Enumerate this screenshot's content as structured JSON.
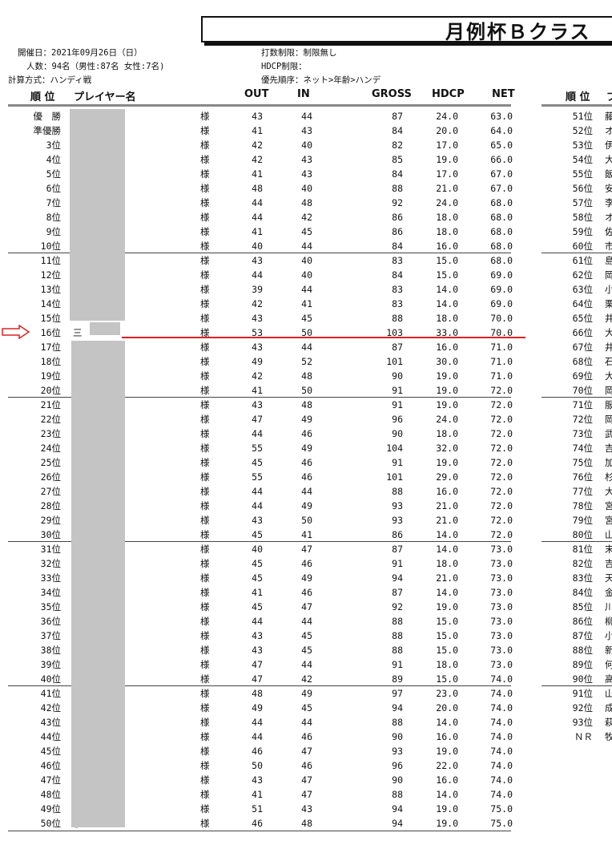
{
  "title": "月例杯Ｂクラス",
  "meta": {
    "date": "開催日：2021年09月26日（日）",
    "count": "人数：94名（男性:87名 女性:7名)",
    "calc": "計算方式：ハンディ戦",
    "limit": "打数制限：制限無し",
    "hdcp_limit": "HDCP制限：",
    "priority": "優先順序：ネット>年齢>ハンデ"
  },
  "headers": {
    "rank": "順 位",
    "player": "プレイヤー名",
    "out": "OUT",
    "in": "IN",
    "gross": "GROSS",
    "hdcp": "HDCP",
    "net": "NET",
    "rank2": "順 位",
    "player2_partial": "プ"
  },
  "honorific": "様",
  "left_rows": [
    {
      "rank": "優　勝",
      "name": "",
      "out": "43",
      "in": "44",
      "gross": "87",
      "hdcp": "24.0",
      "net": "63.0"
    },
    {
      "rank": "準優勝",
      "name": "",
      "out": "41",
      "in": "43",
      "gross": "84",
      "hdcp": "20.0",
      "net": "64.0"
    },
    {
      "rank": "3位",
      "name": "",
      "out": "42",
      "in": "40",
      "gross": "82",
      "hdcp": "17.0",
      "net": "65.0"
    },
    {
      "rank": "4位",
      "name": "",
      "out": "42",
      "in": "43",
      "gross": "85",
      "hdcp": "19.0",
      "net": "66.0"
    },
    {
      "rank": "5位",
      "name": "",
      "out": "41",
      "in": "43",
      "gross": "84",
      "hdcp": "17.0",
      "net": "67.0"
    },
    {
      "rank": "6位",
      "name": "",
      "out": "48",
      "in": "40",
      "gross": "88",
      "hdcp": "21.0",
      "net": "67.0"
    },
    {
      "rank": "7位",
      "name": "",
      "out": "44",
      "in": "48",
      "gross": "92",
      "hdcp": "24.0",
      "net": "68.0"
    },
    {
      "rank": "8位",
      "name": "",
      "out": "44",
      "in": "42",
      "gross": "86",
      "hdcp": "18.0",
      "net": "68.0"
    },
    {
      "rank": "9位",
      "name": "",
      "out": "41",
      "in": "45",
      "gross": "86",
      "hdcp": "18.0",
      "net": "68.0"
    },
    {
      "rank": "10位",
      "name": "",
      "out": "40",
      "in": "44",
      "gross": "84",
      "hdcp": "16.0",
      "net": "68.0"
    },
    {
      "rank": "11位",
      "name": "",
      "out": "43",
      "in": "40",
      "gross": "83",
      "hdcp": "15.0",
      "net": "68.0"
    },
    {
      "rank": "12位",
      "name": "",
      "out": "44",
      "in": "40",
      "gross": "84",
      "hdcp": "15.0",
      "net": "69.0"
    },
    {
      "rank": "13位",
      "name": "",
      "out": "39",
      "in": "44",
      "gross": "83",
      "hdcp": "14.0",
      "net": "69.0"
    },
    {
      "rank": "14位",
      "name": "",
      "out": "42",
      "in": "41",
      "gross": "83",
      "hdcp": "14.0",
      "net": "69.0"
    },
    {
      "rank": "15位",
      "name": "",
      "out": "43",
      "in": "45",
      "gross": "88",
      "hdcp": "18.0",
      "net": "70.0"
    },
    {
      "rank": "16位",
      "name": "三",
      "out": "53",
      "in": "50",
      "gross": "103",
      "hdcp": "33.0",
      "net": "70.0"
    },
    {
      "rank": "17位",
      "name": "",
      "out": "43",
      "in": "44",
      "gross": "87",
      "hdcp": "16.0",
      "net": "71.0"
    },
    {
      "rank": "18位",
      "name": "",
      "out": "49",
      "in": "52",
      "gross": "101",
      "hdcp": "30.0",
      "net": "71.0"
    },
    {
      "rank": "19位",
      "name": "",
      "out": "42",
      "in": "48",
      "gross": "90",
      "hdcp": "19.0",
      "net": "71.0"
    },
    {
      "rank": "20位",
      "name": "",
      "out": "41",
      "in": "50",
      "gross": "91",
      "hdcp": "19.0",
      "net": "72.0"
    },
    {
      "rank": "21位",
      "name": "",
      "out": "43",
      "in": "48",
      "gross": "91",
      "hdcp": "19.0",
      "net": "72.0"
    },
    {
      "rank": "22位",
      "name": "",
      "out": "47",
      "in": "49",
      "gross": "96",
      "hdcp": "24.0",
      "net": "72.0"
    },
    {
      "rank": "23位",
      "name": "",
      "out": "44",
      "in": "46",
      "gross": "90",
      "hdcp": "18.0",
      "net": "72.0"
    },
    {
      "rank": "24位",
      "name": "",
      "out": "55",
      "in": "49",
      "gross": "104",
      "hdcp": "32.0",
      "net": "72.0"
    },
    {
      "rank": "25位",
      "name": "",
      "out": "45",
      "in": "46",
      "gross": "91",
      "hdcp": "19.0",
      "net": "72.0"
    },
    {
      "rank": "26位",
      "name": "吾",
      "out": "55",
      "in": "46",
      "gross": "101",
      "hdcp": "29.0",
      "net": "72.0"
    },
    {
      "rank": "27位",
      "name": "正",
      "out": "44",
      "in": "44",
      "gross": "88",
      "hdcp": "16.0",
      "net": "72.0"
    },
    {
      "rank": "28位",
      "name": "",
      "out": "44",
      "in": "49",
      "gross": "93",
      "hdcp": "21.0",
      "net": "72.0"
    },
    {
      "rank": "29位",
      "name": "",
      "out": "43",
      "in": "50",
      "gross": "93",
      "hdcp": "21.0",
      "net": "72.0"
    },
    {
      "rank": "30位",
      "name": "",
      "out": "45",
      "in": "41",
      "gross": "86",
      "hdcp": "14.0",
      "net": "72.0"
    },
    {
      "rank": "31位",
      "name": "",
      "out": "40",
      "in": "47",
      "gross": "87",
      "hdcp": "14.0",
      "net": "73.0"
    },
    {
      "rank": "32位",
      "name": "",
      "out": "45",
      "in": "46",
      "gross": "91",
      "hdcp": "18.0",
      "net": "73.0"
    },
    {
      "rank": "33位",
      "name": "",
      "out": "45",
      "in": "49",
      "gross": "94",
      "hdcp": "21.0",
      "net": "73.0"
    },
    {
      "rank": "34位",
      "name": "",
      "out": "41",
      "in": "46",
      "gross": "87",
      "hdcp": "14.0",
      "net": "73.0"
    },
    {
      "rank": "35位",
      "name": "",
      "out": "45",
      "in": "47",
      "gross": "92",
      "hdcp": "19.0",
      "net": "73.0"
    },
    {
      "rank": "36位",
      "name": "",
      "out": "44",
      "in": "44",
      "gross": "88",
      "hdcp": "15.0",
      "net": "73.0"
    },
    {
      "rank": "37位",
      "name": "ー",
      "out": "43",
      "in": "45",
      "gross": "88",
      "hdcp": "15.0",
      "net": "73.0"
    },
    {
      "rank": "38位",
      "name": "",
      "out": "43",
      "in": "45",
      "gross": "88",
      "hdcp": "15.0",
      "net": "73.0"
    },
    {
      "rank": "39位",
      "name": "",
      "out": "47",
      "in": "44",
      "gross": "91",
      "hdcp": "18.0",
      "net": "73.0"
    },
    {
      "rank": "40位",
      "name": "",
      "out": "47",
      "in": "42",
      "gross": "89",
      "hdcp": "15.0",
      "net": "74.0"
    },
    {
      "rank": "41位",
      "name": "",
      "out": "48",
      "in": "49",
      "gross": "97",
      "hdcp": "23.0",
      "net": "74.0"
    },
    {
      "rank": "42位",
      "name": "",
      "out": "49",
      "in": "45",
      "gross": "94",
      "hdcp": "20.0",
      "net": "74.0"
    },
    {
      "rank": "43位",
      "name": "志",
      "out": "44",
      "in": "44",
      "gross": "88",
      "hdcp": "14.0",
      "net": "74.0"
    },
    {
      "rank": "44位",
      "name": "",
      "out": "44",
      "in": "46",
      "gross": "90",
      "hdcp": "16.0",
      "net": "74.0"
    },
    {
      "rank": "45位",
      "name": "",
      "out": "46",
      "in": "47",
      "gross": "93",
      "hdcp": "19.0",
      "net": "74.0"
    },
    {
      "rank": "46位",
      "name": "",
      "out": "50",
      "in": "46",
      "gross": "96",
      "hdcp": "22.0",
      "net": "74.0"
    },
    {
      "rank": "47位",
      "name": "",
      "out": "43",
      "in": "47",
      "gross": "90",
      "hdcp": "16.0",
      "net": "74.0"
    },
    {
      "rank": "48位",
      "name": "路",
      "out": "41",
      "in": "47",
      "gross": "88",
      "hdcp": "14.0",
      "net": "74.0"
    },
    {
      "rank": "49位",
      "name": "",
      "out": "51",
      "in": "43",
      "gross": "94",
      "hdcp": "19.0",
      "net": "75.0"
    },
    {
      "rank": "50位",
      "name": "子",
      "out": "46",
      "in": "48",
      "gross": "94",
      "hdcp": "19.0",
      "net": "75.0"
    }
  ],
  "right_rows": [
    {
      "rank": "51位",
      "name": "藤"
    },
    {
      "rank": "52位",
      "name": "オ"
    },
    {
      "rank": "53位",
      "name": "伊"
    },
    {
      "rank": "54位",
      "name": "大"
    },
    {
      "rank": "55位",
      "name": "飯"
    },
    {
      "rank": "56位",
      "name": "安"
    },
    {
      "rank": "57位",
      "name": "李"
    },
    {
      "rank": "58位",
      "name": "オ"
    },
    {
      "rank": "59位",
      "name": "佐"
    },
    {
      "rank": "60位",
      "name": "市"
    },
    {
      "rank": "61位",
      "name": "島"
    },
    {
      "rank": "62位",
      "name": "岡"
    },
    {
      "rank": "63位",
      "name": "小"
    },
    {
      "rank": "64位",
      "name": "栗"
    },
    {
      "rank": "65位",
      "name": "井"
    },
    {
      "rank": "66位",
      "name": "大"
    },
    {
      "rank": "67位",
      "name": "井"
    },
    {
      "rank": "68位",
      "name": "石"
    },
    {
      "rank": "69位",
      "name": "大"
    },
    {
      "rank": "70位",
      "name": "岡"
    },
    {
      "rank": "71位",
      "name": "服"
    },
    {
      "rank": "72位",
      "name": "岡"
    },
    {
      "rank": "73位",
      "name": "武"
    },
    {
      "rank": "74位",
      "name": "吉"
    },
    {
      "rank": "75位",
      "name": "加"
    },
    {
      "rank": "76位",
      "name": "杉"
    },
    {
      "rank": "77位",
      "name": "大"
    },
    {
      "rank": "78位",
      "name": "宮"
    },
    {
      "rank": "79位",
      "name": "宮"
    },
    {
      "rank": "80位",
      "name": "山"
    },
    {
      "rank": "81位",
      "name": "末"
    },
    {
      "rank": "82位",
      "name": "吉"
    },
    {
      "rank": "83位",
      "name": "天"
    },
    {
      "rank": "84位",
      "name": "金"
    },
    {
      "rank": "85位",
      "name": "川"
    },
    {
      "rank": "86位",
      "name": "柳"
    },
    {
      "rank": "87位",
      "name": "小"
    },
    {
      "rank": "88位",
      "name": "新"
    },
    {
      "rank": "89位",
      "name": "何"
    },
    {
      "rank": "90位",
      "name": "高"
    },
    {
      "rank": "91位",
      "name": "山"
    },
    {
      "rank": "92位",
      "name": "成"
    },
    {
      "rank": "93位",
      "name": "萩"
    },
    {
      "rank": "ＮＲ",
      "name": "牧"
    }
  ]
}
